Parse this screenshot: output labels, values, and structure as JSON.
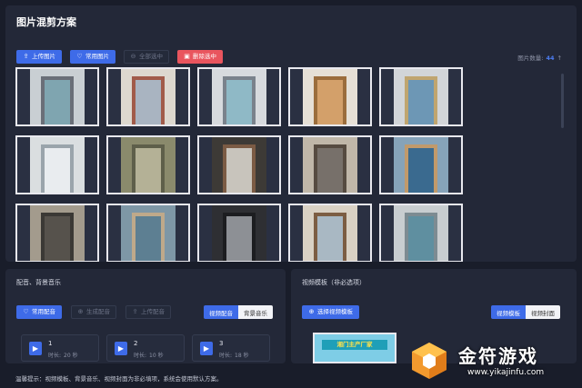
{
  "title": "图片混剪方案",
  "toolbar": {
    "upload_label": "上传图片",
    "common_label": "常用图片",
    "select_all_label": "全部选中",
    "delete_label": "删除选中"
  },
  "image_count": {
    "label": "图片数量:",
    "value": "44"
  },
  "images": [
    {
      "bg": "#c9cfd3",
      "door": "#7fa5b0",
      "frame": "#6a6f78"
    },
    {
      "bg": "#ddd8cf",
      "door": "#a9b4c1",
      "frame": "#a15b4a"
    },
    {
      "bg": "#d7dade",
      "door": "#8fb9c6",
      "frame": "#7a828c"
    },
    {
      "bg": "#e6e0d6",
      "door": "#d3a06a",
      "frame": "#9b6d3c"
    },
    {
      "bg": "#d2d5d8",
      "door": "#6d97b5",
      "frame": "#c0a56f"
    },
    {
      "bg": "#dadee0",
      "door": "#e9ecef",
      "frame": "#9aa4ab"
    },
    {
      "bg": "#8a8a6c",
      "door": "#b4b196",
      "frame": "#5e5f4a"
    },
    {
      "bg": "#3d3a36",
      "door": "#c8c4bc",
      "frame": "#7b5b44"
    },
    {
      "bg": "#c0b7a9",
      "door": "#77706a",
      "frame": "#564b41"
    },
    {
      "bg": "#86a3b9",
      "door": "#3a6a8f",
      "frame": "#c19a6b"
    },
    {
      "bg": "#a39b8d",
      "door": "#56524c",
      "frame": "#3b3935"
    },
    {
      "bg": "#7e97a6",
      "door": "#5d7f92",
      "frame": "#bfa98a"
    },
    {
      "bg": "#2e2f33",
      "door": "#8d9095",
      "frame": "#1c1d20"
    },
    {
      "bg": "#d9d1c4",
      "door": "#a9b8c3",
      "frame": "#7c5d43"
    },
    {
      "bg": "#c8cdd0",
      "door": "#5f8fa0",
      "frame": "#7d8b92"
    }
  ],
  "music": {
    "title": "配音、背景音乐",
    "common_label": "常用配音",
    "generate_label": "生成配音",
    "upload_label": "上传配音",
    "seg_voice": "视频配音",
    "seg_bgm": "背景音乐",
    "tracks": [
      {
        "no": "1",
        "label": "时长:",
        "length": "20 秒"
      },
      {
        "no": "2",
        "label": "时长:",
        "length": "10 秒"
      },
      {
        "no": "3",
        "label": "时长:",
        "length": "18 秒"
      }
    ]
  },
  "template": {
    "title": "视频模板（非必选项）",
    "select_label": "选择视频模板",
    "seg_template": "视频模板",
    "seg_cover": "视频封面",
    "banner_text": "湘门主产厂家"
  },
  "tip": "温馨提示：视频模板、背景音乐、视频封面为非必填项，系统会使用默认方案。",
  "watermark": {
    "name": "金符游戏",
    "url": "www.yikajinfu.com"
  },
  "colors": {
    "accent": "#3e6be8",
    "danger": "#e9555e",
    "panel": "#232838",
    "background": "#191d2a"
  }
}
